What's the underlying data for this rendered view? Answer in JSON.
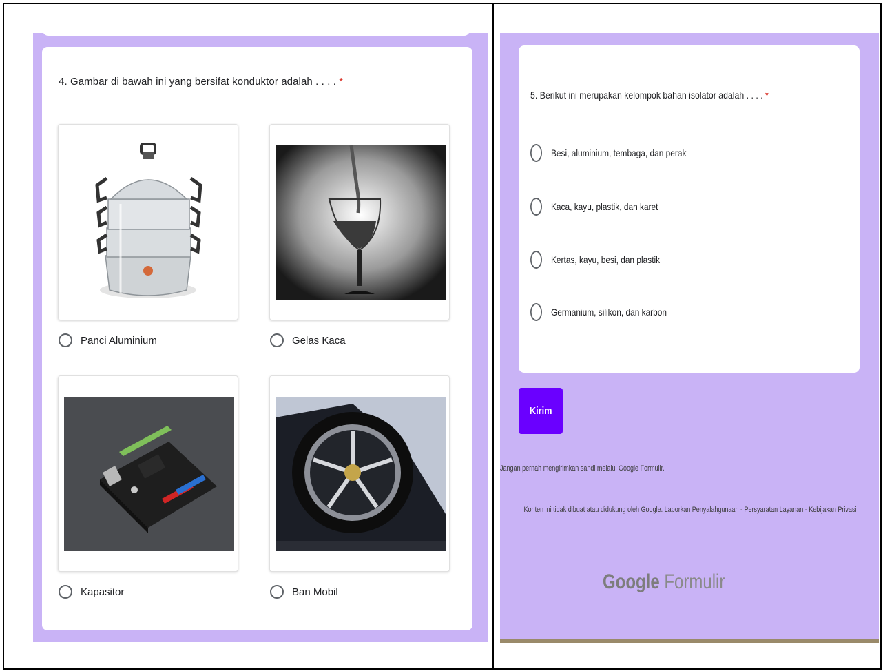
{
  "question4": {
    "number_title": "4. Gambar di bawah ini yang bersifat konduktor adalah . . . .",
    "required_mark": "*",
    "options": [
      {
        "label": "Panci Aluminium",
        "image_icon": "aluminium-steamer-pot-image"
      },
      {
        "label": "Gelas Kaca",
        "image_icon": "wine-glass-pouring-image"
      },
      {
        "label": "Kapasitor",
        "image_icon": "circuit-board-image"
      },
      {
        "label": "Ban Mobil",
        "image_icon": "car-wheel-image"
      }
    ]
  },
  "question5": {
    "number_title": "5. Berikut ini merupakan kelompok bahan isolator adalah . . . .",
    "required_mark": "*",
    "options": [
      "Besi, aluminium, tembaga, dan perak",
      "Kaca, kayu, plastik, dan karet",
      "Kertas, kayu, besi, dan plastik",
      "Germanium, silikon, dan karbon"
    ]
  },
  "submit_label": "Kirim",
  "footer": {
    "warning": "Jangan pernah mengirimkan sandi melalui Google Formulir.",
    "disclaimer_prefix": "Konten ini tidak dibuat atau didukung oleh Google.",
    "link_report": "Laporkan Penyalahgunaan",
    "sep1": " - ",
    "link_terms": "Persyaratan Layanan",
    "sep2": " - ",
    "link_privacy": "Kebijakan Privasi",
    "brand_google": "Google",
    "brand_product": "Formulir"
  },
  "colors": {
    "background_lavender": "#c9b3f6",
    "submit_purple": "#6a00ff",
    "required_red": "#d93025"
  }
}
